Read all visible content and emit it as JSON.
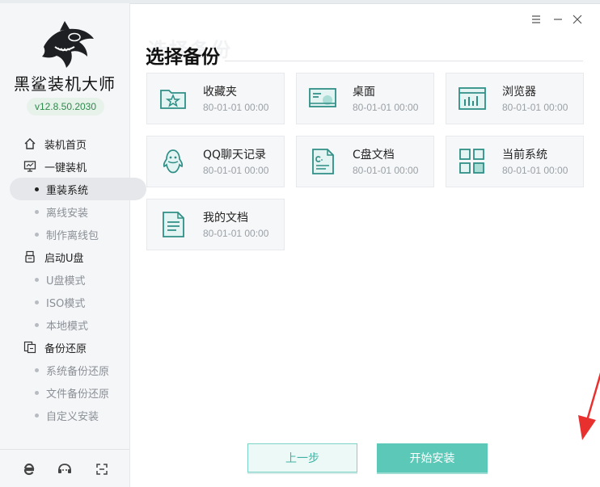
{
  "app": {
    "name": "黑鲨装机大师",
    "version": "v12.8.50.2030"
  },
  "sidebar": {
    "sections": [
      {
        "label": "装机首页",
        "icon": "home-icon",
        "items": []
      },
      {
        "label": "一键装机",
        "icon": "monitor-icon",
        "items": [
          {
            "label": "重装系统",
            "active": true
          },
          {
            "label": "离线安装",
            "active": false
          },
          {
            "label": "制作离线包",
            "active": false
          }
        ]
      },
      {
        "label": "启动U盘",
        "icon": "usb-drive-icon",
        "items": [
          {
            "label": "U盘模式",
            "active": false
          },
          {
            "label": "ISO模式",
            "active": false
          },
          {
            "label": "本地模式",
            "active": false
          }
        ]
      },
      {
        "label": "备份还原",
        "icon": "backup-icon",
        "items": [
          {
            "label": "系统备份还原",
            "active": false
          },
          {
            "label": "文件备份还原",
            "active": false
          },
          {
            "label": "自定义安装",
            "active": false
          }
        ]
      }
    ],
    "footer_icons": [
      "browser-e-icon",
      "chat-support-icon",
      "fullscreen-icon"
    ]
  },
  "window": {
    "controls": [
      "menu-icon",
      "minimize-icon",
      "close-icon"
    ]
  },
  "main": {
    "title": "选择备份",
    "ghost_title": "选择备份",
    "cards": [
      {
        "name": "收藏夹",
        "date": "80-01-01 00:00",
        "icon": "favorites-folder-icon"
      },
      {
        "name": "桌面",
        "date": "80-01-01 00:00",
        "icon": "desktop-icon"
      },
      {
        "name": "浏览器",
        "date": "80-01-01 00:00",
        "icon": "browser-window-icon"
      },
      {
        "name": "QQ聊天记录",
        "date": "80-01-01 00:00",
        "icon": "qq-penguin-icon"
      },
      {
        "name": "C盘文档",
        "date": "80-01-01 00:00",
        "icon": "c-drive-document-icon"
      },
      {
        "name": "当前系统",
        "date": "80-01-01 00:00",
        "icon": "system-grid-icon"
      },
      {
        "name": "我的文档",
        "date": "80-01-01 00:00",
        "icon": "my-documents-icon"
      }
    ],
    "buttons": {
      "prev": "上一步",
      "start": "开始安装"
    }
  },
  "colors": {
    "accent": "#5cc9b8",
    "version_text": "#2d8a4b",
    "annotation_arrow": "#e8312f"
  }
}
